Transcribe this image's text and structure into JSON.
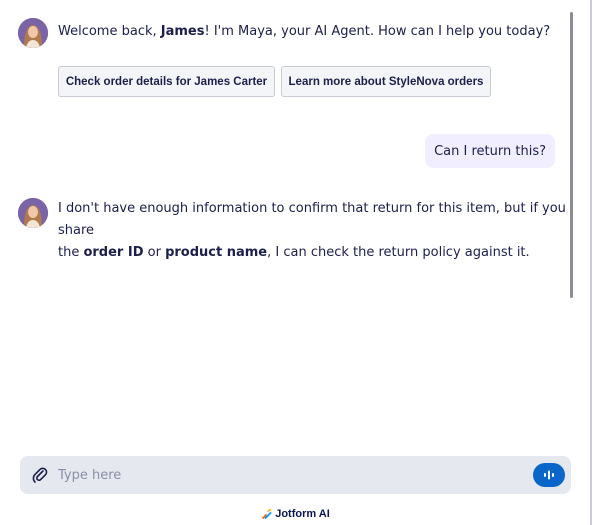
{
  "messages": [
    {
      "role": "agent",
      "parts": [
        "Welcome back, ",
        "James",
        "! I'm Maya, your AI Agent. How can I help you today?"
      ]
    },
    {
      "role": "user",
      "text": "Can I return this?"
    },
    {
      "role": "agent",
      "lines": [
        "I don't have enough information to confirm that return for this item, but if you share",
        [
          "the ",
          "order ID",
          " or ",
          "product name",
          ", I can check the return policy against it."
        ]
      ]
    }
  ],
  "suggestions": [
    "Check order details for James Carter",
    "Learn more about StyleNova orders"
  ],
  "composer": {
    "placeholder": "Type here"
  },
  "branding": {
    "text": "Jotform AI"
  },
  "colors": {
    "accent": "#0a66c8",
    "user_bubble": "#f1efff",
    "composer_bg": "#e6e8f0",
    "text": "#1b1f4b"
  },
  "icons": {
    "avatar": "agent-avatar",
    "attach": "paperclip-icon",
    "voice": "voice-bars-icon",
    "brand": "jotform-logo"
  }
}
